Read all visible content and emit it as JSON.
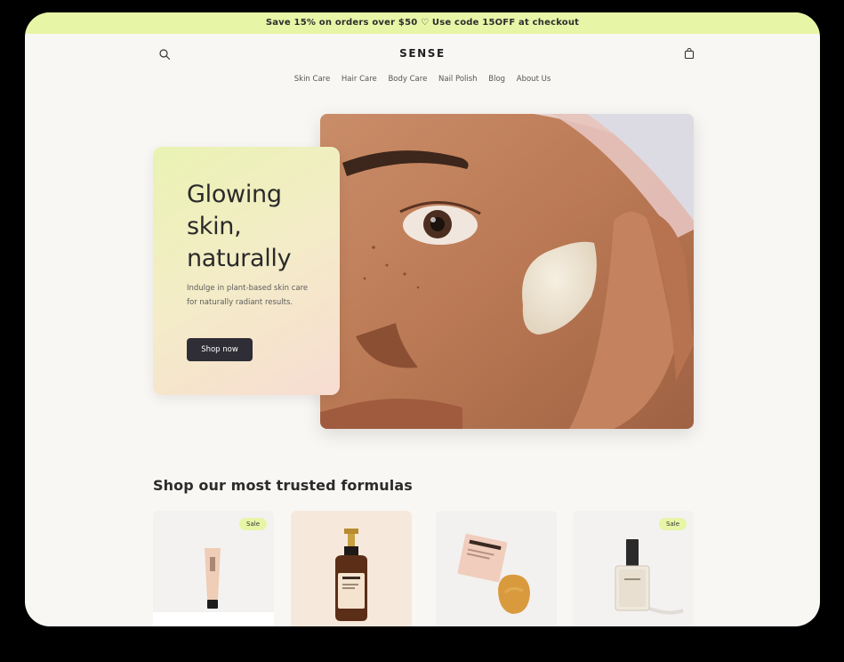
{
  "announcement": "Save 15% on orders over $50 ♡ Use code 15OFF at checkout",
  "header": {
    "brand": "SENSE",
    "search_icon": "search-icon",
    "cart_icon": "bag-icon"
  },
  "nav": {
    "items": [
      {
        "label": "Skin Care"
      },
      {
        "label": "Hair Care"
      },
      {
        "label": "Body Care"
      },
      {
        "label": "Nail Polish"
      },
      {
        "label": "Blog"
      },
      {
        "label": "About Us"
      }
    ]
  },
  "hero": {
    "title": "Glowing skin, naturally",
    "subtitle": "Indulge in plant-based skin care for naturally radiant results.",
    "button_label": "Shop now"
  },
  "products_section": {
    "title": "Shop our most trusted formulas",
    "products": [
      {
        "badge": "Sale",
        "kind": "tube",
        "background": "#f3f2f1"
      },
      {
        "badge": "",
        "kind": "pump-bottle",
        "background": "#f6e9dc"
      },
      {
        "badge": "",
        "kind": "box-and-sponge",
        "background": "#f2f1f0"
      },
      {
        "badge": "Sale",
        "kind": "nail-polish",
        "background": "#f3f2f1"
      }
    ]
  },
  "colors": {
    "accent": "#e7f5a6",
    "button": "#2f2e36",
    "page_bg": "#f9f7f4"
  }
}
